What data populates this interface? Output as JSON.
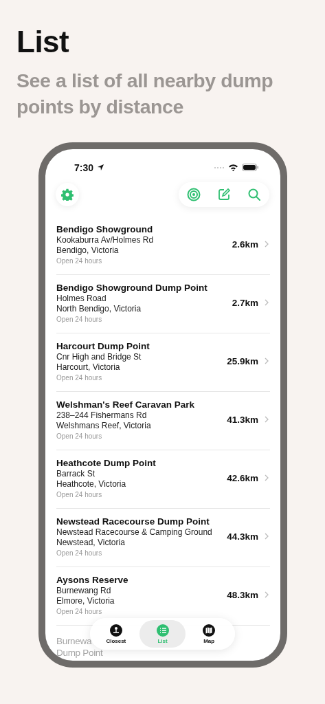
{
  "header": {
    "title": "List",
    "subtitle": "See a list of all nearby dump points by distance"
  },
  "status_bar": {
    "time": "7:30"
  },
  "places": [
    {
      "name": "Bendigo Showground",
      "street": "Kookaburra Av/Holmes Rd",
      "town": "Bendigo, Victoria",
      "hours": "Open 24 hours",
      "distance": "2.6km"
    },
    {
      "name": "Bendigo Showground Dump Point",
      "street": "Holmes Road",
      "town": "North Bendigo, Victoria",
      "hours": "Open 24 hours",
      "distance": "2.7km"
    },
    {
      "name": "Harcourt Dump Point",
      "street": "Cnr High and Bridge St",
      "town": "Harcourt, Victoria",
      "hours": "Open 24 hours",
      "distance": "25.9km"
    },
    {
      "name": "Welshman's Reef Caravan Park",
      "street": "238–244 Fishermans Rd",
      "town": "Welshmans Reef, Victoria",
      "hours": "Open 24 hours",
      "distance": "41.3km"
    },
    {
      "name": "Heathcote Dump Point",
      "street": "Barrack St",
      "town": "Heathcote, Victoria",
      "hours": "Open 24 hours",
      "distance": "42.6km"
    },
    {
      "name": "Newstead Racecourse Dump Point",
      "street": "Newstead Racecourse & Camping Ground",
      "town": "Newstead, Victoria",
      "hours": "Open 24 hours",
      "distance": "44.3km"
    },
    {
      "name": "Aysons Reserve",
      "street": "Burnewang Rd",
      "town": "Elmore, Victoria",
      "hours": "Open 24 hours",
      "distance": "48.3km"
    }
  ],
  "partial_place": {
    "name_start": "Burnewa",
    "name_end": "Dump Point"
  },
  "tabs": [
    {
      "label": "Closest",
      "kind": "closest",
      "selected": false
    },
    {
      "label": "List",
      "kind": "list",
      "selected": true
    },
    {
      "label": "Map",
      "kind": "map",
      "selected": false
    }
  ]
}
